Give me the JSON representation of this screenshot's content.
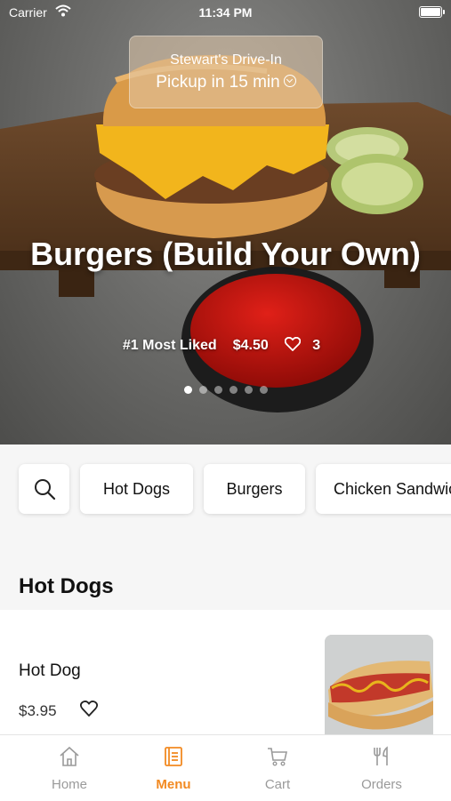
{
  "status_bar": {
    "carrier": "Carrier",
    "time": "11:34 PM"
  },
  "store": {
    "name": "Stewart's Drive-In",
    "pickup": "Pickup in 15 min"
  },
  "featured": {
    "title": "Burgers (Build Your Own)",
    "rank": "#1 Most Liked",
    "price": "$4.50",
    "likes": "3",
    "slides_total": 6,
    "slide_active": 1
  },
  "categories": {
    "search_icon": "search-icon",
    "items": [
      "Hot Dogs",
      "Burgers",
      "Chicken Sandwiches"
    ]
  },
  "section": {
    "title": "Hot Dogs"
  },
  "menu_item": {
    "name": "Hot Dog",
    "price": "$3.95"
  },
  "tabs": [
    {
      "label": "Home",
      "icon": "home-icon",
      "active": false
    },
    {
      "label": "Menu",
      "icon": "menu-icon",
      "active": true
    },
    {
      "label": "Cart",
      "icon": "cart-icon",
      "active": false
    },
    {
      "label": "Orders",
      "icon": "fork-knife-icon",
      "active": false
    }
  ],
  "colors": {
    "accent": "#f28a22",
    "inactive": "#9a9a9a"
  }
}
